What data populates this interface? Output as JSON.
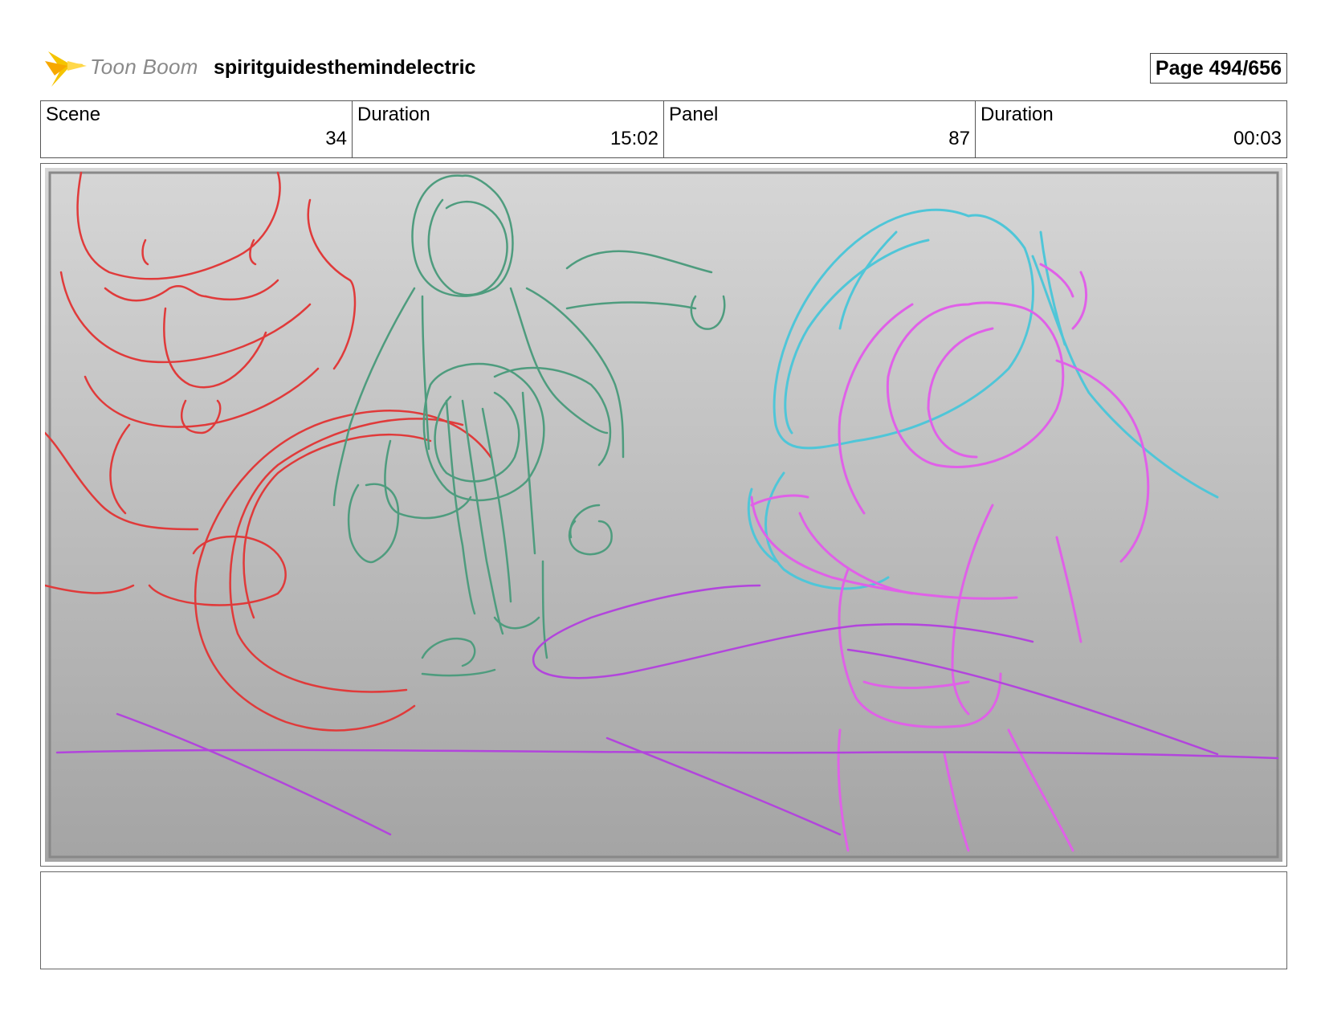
{
  "header": {
    "logo_text": "Toon Boom",
    "project_title": "spiritguidesthemindelectric",
    "page_label": "Page 494/656"
  },
  "info": [
    {
      "label": "Scene",
      "value": "34"
    },
    {
      "label": "Duration",
      "value": "15:02"
    },
    {
      "label": "Panel",
      "value": "87"
    },
    {
      "label": "Duration",
      "value": "00:03"
    }
  ],
  "sketch": {
    "colors": {
      "red": "#e03a3a",
      "green": "#4e9c7e",
      "cyan": "#4fc6d8",
      "magenta": "#e060e8",
      "purple": "#b245dc"
    }
  },
  "caption": {
    "text": ""
  }
}
